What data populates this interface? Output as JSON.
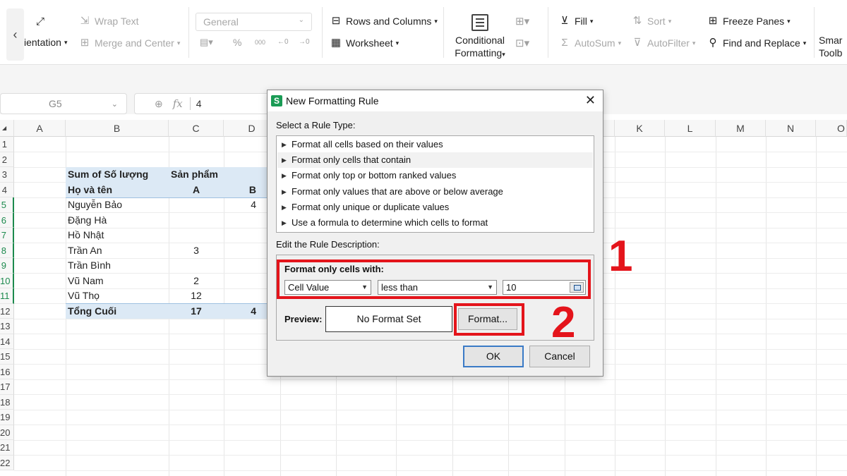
{
  "ribbon": {
    "orientation_label": "ientation",
    "wrap_text": "Wrap Text",
    "merge_center": "Merge and Center",
    "number_format": "General",
    "percent": "%",
    "thousands": "000",
    "dec_inc": "←0",
    "dec_dec": "→0",
    "rows_columns": "Rows and Columns",
    "worksheet": "Worksheet",
    "conditional_formatting_1": "Conditional",
    "conditional_formatting_2": "Formatting",
    "fill": "Fill",
    "autosum": "AutoSum",
    "sort": "Sort",
    "autofilter": "AutoFilter",
    "freeze_panes": "Freeze Panes",
    "find_replace": "Find and Replace",
    "smart_toolbox_1": "Smar",
    "smart_toolbox_2": "Toolb"
  },
  "formula_bar": {
    "cell_ref": "G5",
    "fx": "fx",
    "value": "4"
  },
  "grid": {
    "columns": [
      "A",
      "B",
      "C",
      "D",
      "K",
      "L",
      "M",
      "N",
      "O"
    ],
    "rows": [
      "1",
      "2",
      "3",
      "4",
      "5",
      "6",
      "7",
      "8",
      "9",
      "10",
      "11",
      "12",
      "13",
      "14",
      "15",
      "16",
      "17",
      "18",
      "19",
      "20",
      "21",
      "22"
    ],
    "pivot": {
      "header_sum": "Sum of Số lượng",
      "header_product": "Sản phẩm",
      "header_name": "Họ và tên",
      "col_a": "A",
      "col_b": "B",
      "names": [
        "Nguyễn Bảo",
        "Đặng Hà",
        "Hồ Nhật",
        "Trần An",
        "Trần Bình",
        "Vũ Nam",
        "Vũ Thọ"
      ],
      "a_values": [
        "",
        "",
        "",
        "3",
        "",
        "2",
        "12"
      ],
      "b_values": [
        "4",
        "",
        "",
        "",
        "",
        "",
        ""
      ],
      "total_label": "Tổng Cuối",
      "total_a": "17",
      "total_b": "4"
    }
  },
  "dialog": {
    "title": "New Formatting Rule",
    "logo": "S",
    "select_rule_type_label": "Select a Rule Type:",
    "rule_types": [
      "Format all cells based on their values",
      "Format only cells that contain",
      "Format only top or bottom ranked values",
      "Format only values that are above or below average",
      "Format only unique or duplicate values",
      "Use a formula to determine which cells to format"
    ],
    "edit_description_label": "Edit the Rule Description:",
    "format_only_cells_with": "Format only cells with:",
    "condition_field": "Cell Value",
    "condition_operator": "less than",
    "condition_value": "10",
    "preview_label": "Preview:",
    "preview_text": "No Format Set",
    "format_button": "Format...",
    "ok_button": "OK",
    "cancel_button": "Cancel"
  },
  "annotations": {
    "step1": "1",
    "step2": "2"
  },
  "colors": {
    "highlight_red": "#e4141b",
    "pivot_blue": "#dce9f5",
    "selected_row_green": "#1d8a4e"
  }
}
